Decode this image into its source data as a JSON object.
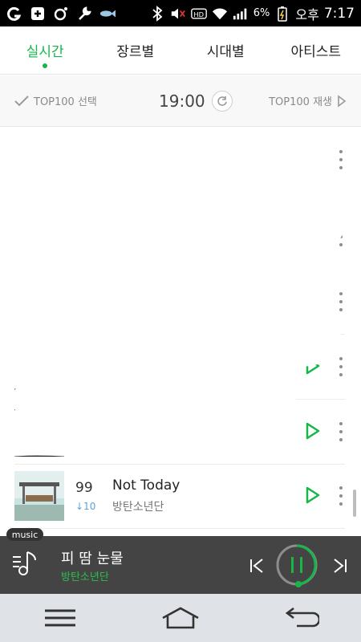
{
  "status_bar": {
    "battery_percent": "6%",
    "ampm": "오후",
    "time": "7:17"
  },
  "tabs": [
    {
      "label": "실시간",
      "active": true
    },
    {
      "label": "장르별",
      "active": false
    },
    {
      "label": "시대별",
      "active": false
    },
    {
      "label": "아티스트",
      "active": false
    }
  ],
  "subbar": {
    "select_label": "TOP100 선택",
    "time": "19:00",
    "play_all_label": "TOP100 재생"
  },
  "visible_items": [
    {
      "rank": "99",
      "change": "↓10",
      "title": "Not Today",
      "artist": "방탄소년단"
    }
  ],
  "player": {
    "tag": "music",
    "title": "피 땀 눈물",
    "artist": "방탄소년단"
  },
  "colors": {
    "accent": "#16b64a",
    "change_down": "#5aa3de",
    "player_bg": "#444444"
  }
}
